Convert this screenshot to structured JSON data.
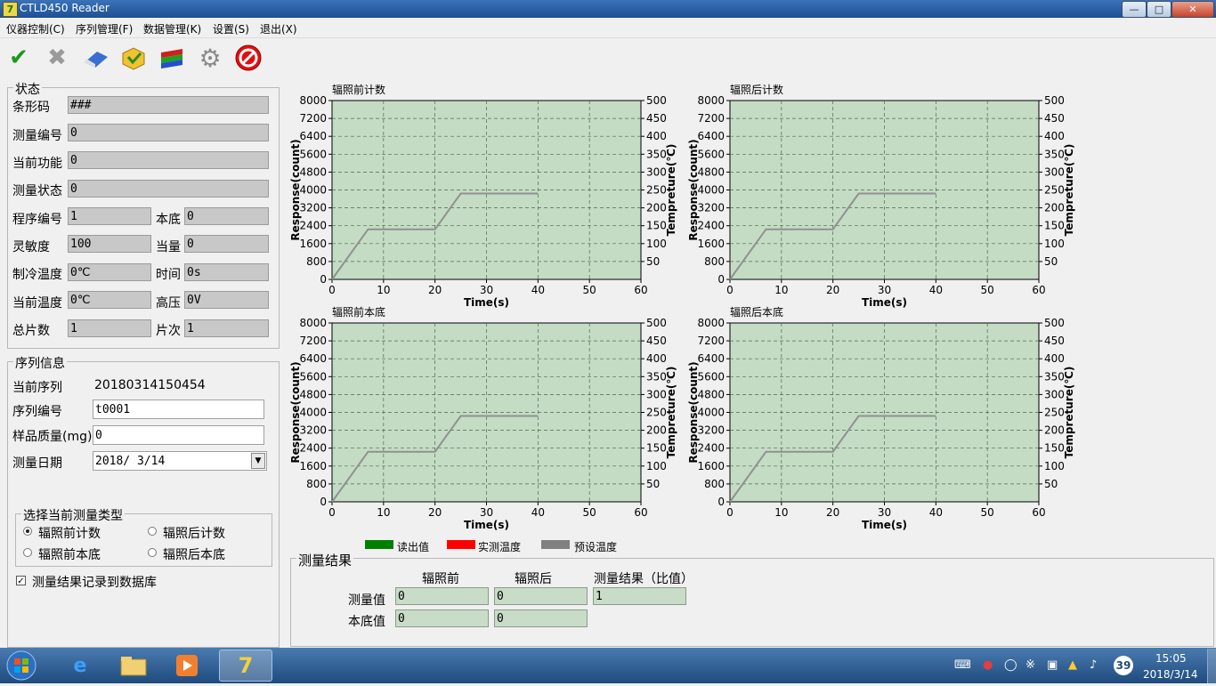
{
  "window": {
    "title": "CTLD450 Reader",
    "min": "0",
    "max": "1",
    "close": "r"
  },
  "menu": [
    "仪器控制(C)",
    "序列管理(F)",
    "数据管理(K)",
    "设置(S)",
    "退出(X)"
  ],
  "toolbar": {
    "icons": [
      "check-icon",
      "cross-icon",
      "eraser-icon",
      "refresh-icon",
      "layers-icon",
      "gear-icon",
      "stop-icon"
    ]
  },
  "status": {
    "title": "状态",
    "barcode_label": "条形码",
    "barcode": "###",
    "measure_no_label": "测量编号",
    "measure_no": "0",
    "current_func_label": "当前功能",
    "current_func": "0",
    "measure_state_label": "测量状态",
    "measure_state": "0",
    "program_no_label": "程序编号",
    "program_no": "1",
    "background_label": "本底",
    "background": "0",
    "sensitivity_label": "灵敏度",
    "sensitivity": "100",
    "dose_label": "当量",
    "dose": "0",
    "cooling_temp_label": "制冷温度",
    "cooling_temp": "0℃",
    "time_label": "时间",
    "time": "0s",
    "current_temp_label": "当前温度",
    "current_temp": "0℃",
    "hv_label": "高压",
    "hv": "0V",
    "total_chips_label": "总片数",
    "total_chips": "1",
    "chip_index_label": "片次",
    "chip_index": "1"
  },
  "sequence": {
    "title": "序列信息",
    "current_seq_label": "当前序列",
    "current_seq": "20180314150454",
    "seq_no_label": "序列编号",
    "seq_no": "t0001",
    "sample_mass_label": "样品质量(mg)",
    "sample_mass": "0",
    "date_label": "测量日期",
    "date": "2018/ 3/14"
  },
  "measure_type": {
    "title": "选择当前测量类型",
    "options": [
      "辐照前计数",
      "辐照后计数",
      "辐照前本底",
      "辐照后本底"
    ],
    "selected": "辐照前计数"
  },
  "record_db": {
    "label": "测量结果记录到数据库",
    "checked": true
  },
  "charts": {
    "titles": [
      "辐照前计数",
      "辐照后计数",
      "辐照前本底",
      "辐照后本底"
    ],
    "ylabel": "Response(count)",
    "y2label": "Tempreture(℃)",
    "xlabel": "Time(s)",
    "legend": [
      {
        "name": "读出值",
        "color": "#008000"
      },
      {
        "name": "实测温度",
        "color": "#ff0000"
      },
      {
        "name": "预设温度",
        "color": "#808080"
      }
    ]
  },
  "chart_data": [
    {
      "type": "line",
      "title": "辐照前计数",
      "xlabel": "Time(s)",
      "ylabel": "Response(count)",
      "y2label": "Tempreture(℃)",
      "xlim": [
        0,
        60
      ],
      "ylim": [
        0,
        8000
      ],
      "y2lim": [
        0,
        500
      ],
      "xticks": [
        0,
        10,
        20,
        30,
        40,
        50,
        60
      ],
      "yticks": [
        0,
        800,
        1600,
        2400,
        3200,
        4000,
        4800,
        5600,
        6400,
        7200,
        8000
      ],
      "y2ticks": [
        50,
        100,
        150,
        200,
        250,
        300,
        350,
        400,
        450,
        500
      ],
      "grid": true,
      "series": [
        {
          "name": "预设温度",
          "axis": "y2",
          "x": [
            0,
            7,
            20,
            25,
            40
          ],
          "y": [
            0,
            140,
            140,
            240,
            240
          ]
        }
      ]
    },
    {
      "type": "line",
      "title": "辐照后计数",
      "xlabel": "Time(s)",
      "ylabel": "Response(count)",
      "y2label": "Tempreture(℃)",
      "xlim": [
        0,
        60
      ],
      "ylim": [
        0,
        8000
      ],
      "y2lim": [
        0,
        500
      ],
      "xticks": [
        0,
        10,
        20,
        30,
        40,
        50,
        60
      ],
      "yticks": [
        0,
        800,
        1600,
        2400,
        3200,
        4000,
        4800,
        5600,
        6400,
        7200,
        8000
      ],
      "y2ticks": [
        50,
        100,
        150,
        200,
        250,
        300,
        350,
        400,
        450,
        500
      ],
      "grid": true,
      "series": [
        {
          "name": "预设温度",
          "axis": "y2",
          "x": [
            0,
            7,
            20,
            25,
            40
          ],
          "y": [
            0,
            140,
            140,
            240,
            240
          ]
        }
      ]
    },
    {
      "type": "line",
      "title": "辐照前本底",
      "xlabel": "Time(s)",
      "ylabel": "Response(count)",
      "y2label": "Tempreture(℃)",
      "xlim": [
        0,
        60
      ],
      "ylim": [
        0,
        8000
      ],
      "y2lim": [
        0,
        500
      ],
      "xticks": [
        0,
        10,
        20,
        30,
        40,
        50,
        60
      ],
      "yticks": [
        0,
        800,
        1600,
        2400,
        3200,
        4000,
        4800,
        5600,
        6400,
        7200,
        8000
      ],
      "y2ticks": [
        50,
        100,
        150,
        200,
        250,
        300,
        350,
        400,
        450,
        500
      ],
      "grid": true,
      "series": [
        {
          "name": "预设温度",
          "axis": "y2",
          "x": [
            0,
            7,
            20,
            25,
            40
          ],
          "y": [
            0,
            140,
            140,
            240,
            240
          ]
        }
      ]
    },
    {
      "type": "line",
      "title": "辐照后本底",
      "xlabel": "Time(s)",
      "ylabel": "Response(count)",
      "y2label": "Tempreture(℃)",
      "xlim": [
        0,
        60
      ],
      "ylim": [
        0,
        8000
      ],
      "y2lim": [
        0,
        500
      ],
      "xticks": [
        0,
        10,
        20,
        30,
        40,
        50,
        60
      ],
      "yticks": [
        0,
        800,
        1600,
        2400,
        3200,
        4000,
        4800,
        5600,
        6400,
        7200,
        8000
      ],
      "y2ticks": [
        50,
        100,
        150,
        200,
        250,
        300,
        350,
        400,
        450,
        500
      ],
      "grid": true,
      "series": [
        {
          "name": "预设温度",
          "axis": "y2",
          "x": [
            0,
            7,
            20,
            25,
            40
          ],
          "y": [
            0,
            140,
            140,
            240,
            240
          ]
        }
      ]
    }
  ],
  "results": {
    "title": "测量结果",
    "col_before": "辐照前",
    "col_after": "辐照后",
    "col_ratio": "测量结果（比值）",
    "row_measure": "测量值",
    "row_bg": "本底值",
    "measure_before": "0",
    "measure_after": "0",
    "ratio": "1",
    "bg_before": "0",
    "bg_after": "0"
  },
  "taskbar": {
    "clock_time": "15:05",
    "clock_date": "2018/3/14",
    "badge": "39",
    "apps": [
      "start-orb-icon",
      "ie-icon",
      "explorer-icon",
      "media-player-icon",
      "ctld-reader-icon"
    ]
  },
  "colors": {
    "plot_bg": "#c4dcc4",
    "grid": "#4a6a4a",
    "curve": "#909090",
    "titlebar": "#2a5fa3"
  }
}
